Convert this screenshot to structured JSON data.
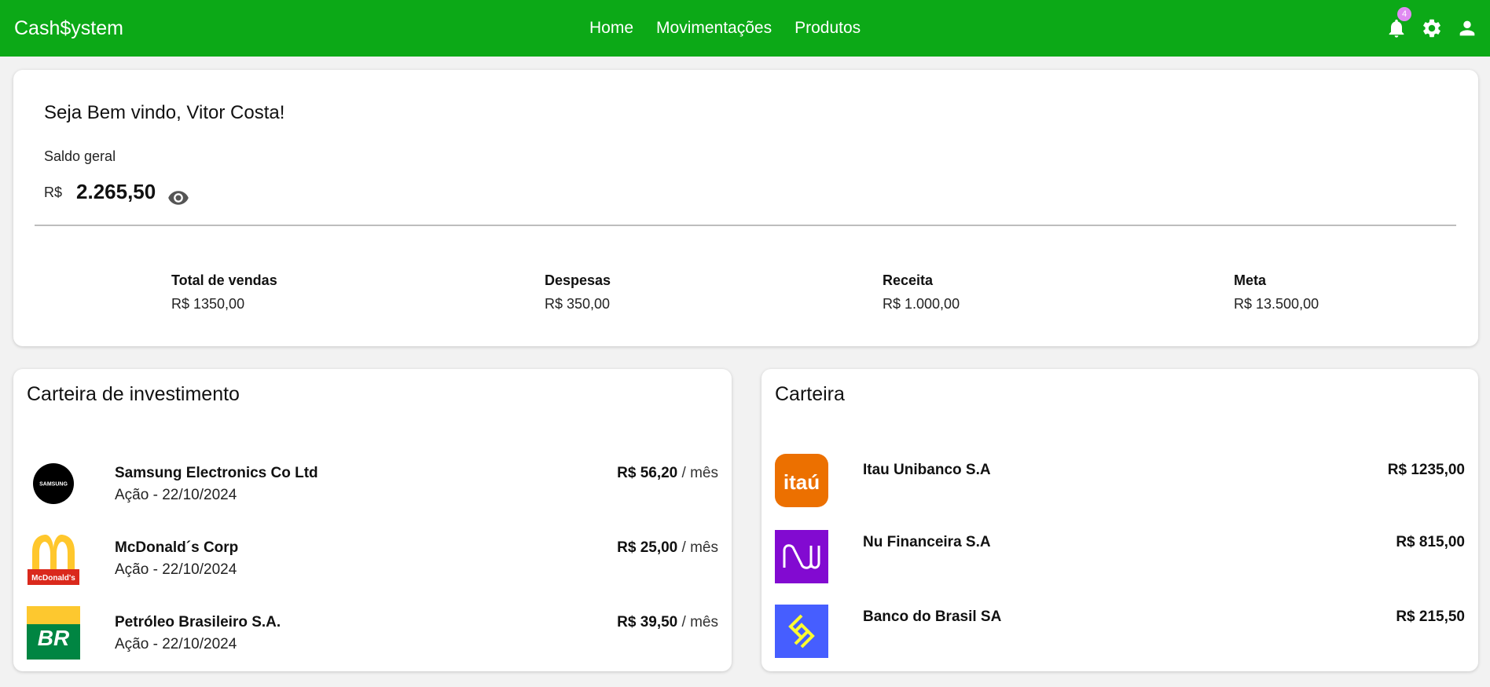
{
  "app": {
    "brand": "Cash$ystem"
  },
  "nav": {
    "items": [
      "Home",
      "Movimentações",
      "Produtos"
    ]
  },
  "actions": {
    "notification_count": "4"
  },
  "summary": {
    "welcome": "Seja Bem vindo, Vitor Costa!",
    "balance_label": "Saldo geral",
    "currency": "R$",
    "balance": "2.265,50",
    "stats": [
      {
        "label": "Total de vendas",
        "value": "R$ 1350,00"
      },
      {
        "label": "Despesas",
        "value": "R$ 350,00"
      },
      {
        "label": "Receita",
        "value": "R$ 1.000,00"
      },
      {
        "label": "Meta",
        "value": "R$ 13.500,00"
      }
    ]
  },
  "investments": {
    "title": "Carteira de investimento",
    "items": [
      {
        "logo": "samsung-logo",
        "logo_text": "SAMSUNG",
        "name": "Samsung Electronics Co Ltd",
        "sub": "Ação - 22/10/2024",
        "amount": "R$ 56,20",
        "period": " / mês"
      },
      {
        "logo": "mcdonalds-logo",
        "logo_text": "McDonald's",
        "name": "McDonald´s Corp",
        "sub": "Ação - 22/10/2024",
        "amount": "R$ 25,00",
        "period": " / mês"
      },
      {
        "logo": "petrobras-logo",
        "logo_text": "BR",
        "name": "Petróleo Brasileiro S.A.",
        "sub": "Ação - 22/10/2024",
        "amount": "R$ 39,50",
        "period": " / mês"
      }
    ]
  },
  "wallet": {
    "title": "Carteira",
    "items": [
      {
        "logo": "itau-logo",
        "logo_text": "itaú",
        "name": "Itau Unibanco S.A",
        "amount": "R$ 1235,00"
      },
      {
        "logo": "nubank-logo",
        "logo_text": "nu",
        "name": "Nu Financeira S.A",
        "amount": "R$ 815,00"
      },
      {
        "logo": "banco-do-brasil-logo",
        "logo_text": "",
        "name": "Banco do Brasil SA",
        "amount": "R$ 215,50"
      }
    ]
  },
  "colors": {
    "topbar": "#0ca917",
    "badge": "#e08bf2",
    "itau": "#ec7000",
    "nubank": "#820ad1",
    "banco_do_brasil": "#465eff",
    "bb_yellow": "#fcfc30",
    "petrobras_green": "#008542",
    "petrobras_yellow": "#fdc82f",
    "mcdonalds_red": "#da291c",
    "mcdonalds_yellow": "#ffc72c"
  }
}
